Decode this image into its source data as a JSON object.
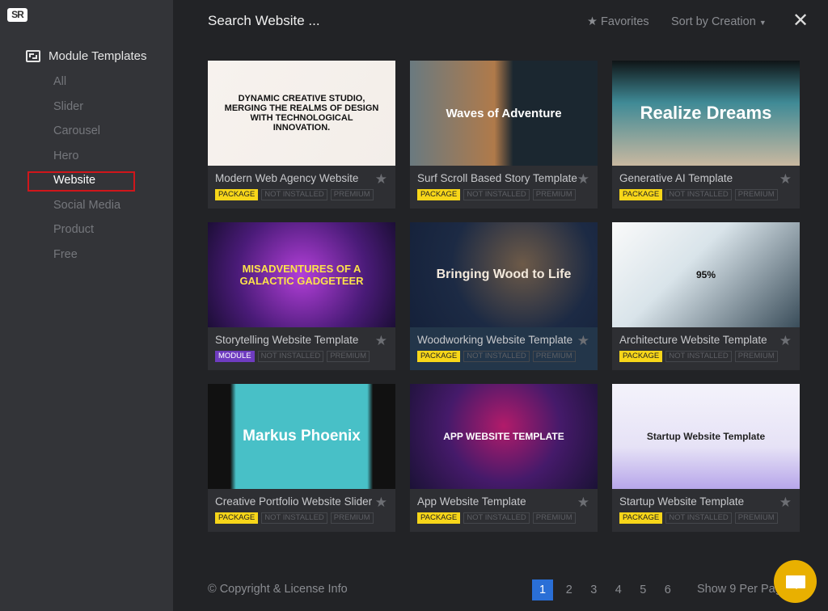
{
  "logo": "SR",
  "sidebar": {
    "section": "Module Templates",
    "items": [
      {
        "label": "All"
      },
      {
        "label": "Slider"
      },
      {
        "label": "Carousel"
      },
      {
        "label": "Hero"
      },
      {
        "label": "Website",
        "active": true
      },
      {
        "label": "Social Media"
      },
      {
        "label": "Product"
      },
      {
        "label": "Free"
      }
    ]
  },
  "header": {
    "search_placeholder": "Search Website ...",
    "favorites": "Favorites",
    "sort": "Sort by Creation",
    "close": "✕"
  },
  "cards": [
    {
      "title": "Modern Web Agency Website",
      "type": "PACKAGE",
      "status": "NOT INSTALLED",
      "tier": "PREMIUM",
      "thumb_text": "DYNAMIC CREATIVE STUDIO, MERGING THE REALMS OF DESIGN WITH TECHNOLOGICAL INNOVATION."
    },
    {
      "title": "Surf Scroll Based Story Template",
      "type": "PACKAGE",
      "status": "NOT INSTALLED",
      "tier": "PREMIUM",
      "thumb_text": "Waves of Adventure"
    },
    {
      "title": "Generative AI Template",
      "type": "PACKAGE",
      "status": "NOT INSTALLED",
      "tier": "PREMIUM",
      "thumb_text": "Realize Dreams"
    },
    {
      "title": "Storytelling Website Template",
      "type": "MODULE",
      "status": "NOT INSTALLED",
      "tier": "PREMIUM",
      "thumb_text": "MISADVENTURES OF A GALACTIC GADGETEER"
    },
    {
      "title": "Woodworking Website Template",
      "type": "PACKAGE",
      "status": "NOT INSTALLED",
      "tier": "PREMIUM",
      "thumb_text": "Bringing Wood to Life"
    },
    {
      "title": "Architecture Website Template",
      "type": "PACKAGE",
      "status": "NOT INSTALLED",
      "tier": "PREMIUM",
      "thumb_text": "95%"
    },
    {
      "title": "Creative Portfolio Website Slider",
      "type": "PACKAGE",
      "status": "NOT INSTALLED",
      "tier": "PREMIUM",
      "thumb_text": "Markus Phoenix"
    },
    {
      "title": "App Website Template",
      "type": "PACKAGE",
      "status": "NOT INSTALLED",
      "tier": "PREMIUM",
      "thumb_text": "APP WEBSITE TEMPLATE"
    },
    {
      "title": "Startup Website Template",
      "type": "PACKAGE",
      "status": "NOT INSTALLED",
      "tier": "PREMIUM",
      "thumb_text": "Startup Website Template"
    }
  ],
  "footer": {
    "copyright": "© Copyright & License Info",
    "pages": [
      "1",
      "2",
      "3",
      "4",
      "5",
      "6"
    ],
    "current_page": "1",
    "per_page": "Show 9 Per Page"
  },
  "colors": {
    "accent": "#2a6fd6",
    "package": "#f7d619",
    "module": "#6f3cc0",
    "chat": "#e9b000",
    "highlight": "#d0161b"
  }
}
